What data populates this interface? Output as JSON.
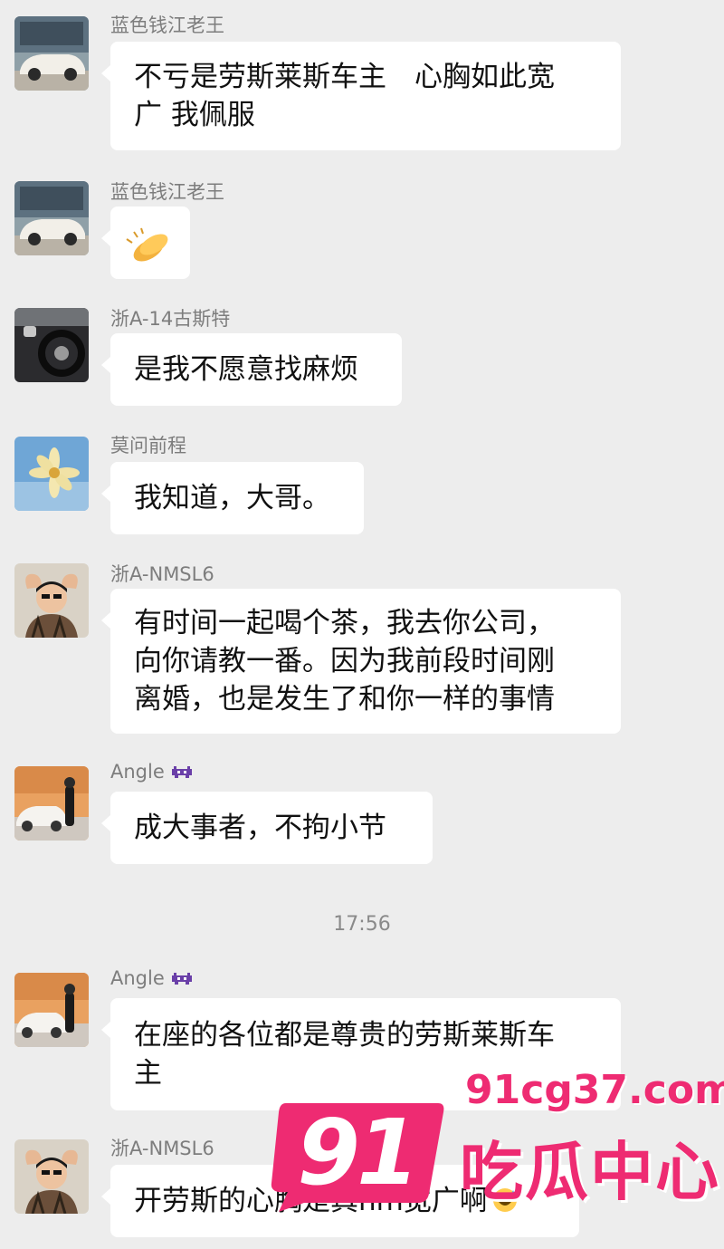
{
  "chat": {
    "messages": [
      {
        "sender": "蓝色钱江老王",
        "lines": [
          "不亏是劳斯莱斯车主　心胸如此宽",
          "广 我佩服"
        ]
      },
      {
        "sender": "蓝色钱江老王",
        "emoji": "clapping-hands-emoji"
      },
      {
        "sender": "浙A-14古斯特",
        "lines": [
          "是我不愿意找麻烦"
        ]
      },
      {
        "sender": "莫问前程",
        "lines": [
          "我知道，大哥。"
        ]
      },
      {
        "sender": "浙A-NMSL6",
        "lines": [
          "有时间一起喝个茶，我去你公司，",
          "向你请教一番。因为我前段时间刚",
          "离婚，也是发生了和你一样的事情"
        ]
      },
      {
        "sender": "Angle",
        "sender_icon": "alien-monster-icon",
        "lines": [
          "成大事者，不拘小节"
        ]
      },
      {
        "sender": "Angle",
        "sender_icon": "alien-monster-icon",
        "lines": [
          "在座的各位都是尊贵的劳斯莱斯车",
          "主"
        ]
      },
      {
        "sender": "浙A-NMSL6",
        "lines": [
          "开劳斯的心胸是真nm宽广啊"
        ],
        "trailing_icon": "grinning-sweat-emoji"
      }
    ],
    "timestamp": "17:56"
  },
  "watermark": {
    "badge": "91",
    "url": "91cg37.com",
    "name": "吃瓜中心",
    "color": "#ee2b72"
  }
}
